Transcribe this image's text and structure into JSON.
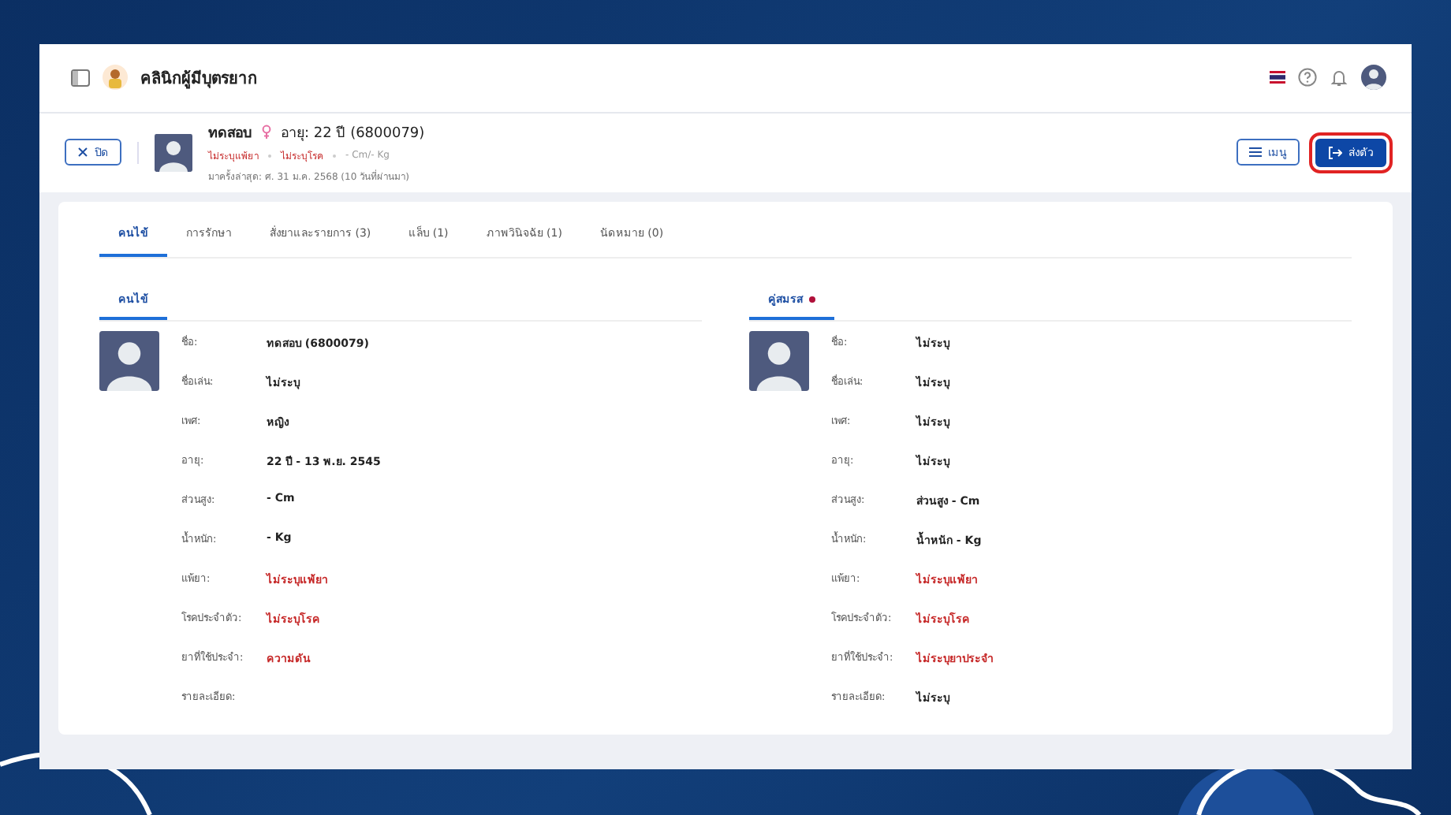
{
  "app_bar": {
    "title": "คลินิกผู้มีบุตรยาก"
  },
  "patient": {
    "name": "ทดสอบ",
    "age": "อายุ: 22 ปี (6800079)",
    "tags": [
      {
        "text": "ไม่ระบุแพ้ยา",
        "kind": "alert"
      },
      {
        "text": "ไม่ระบุโรค",
        "kind": "alert"
      },
      {
        "text": "- Cm/- Kg",
        "kind": "plain"
      }
    ],
    "last_visit": "มาครั้งล่าสุด: ศ. 31 ม.ค. 2568 (10 วันที่ผ่านมา)"
  },
  "close_button": "ปิด",
  "menu_button": "เมนู",
  "send_button": "ส่งตัว",
  "tabs": [
    {
      "label": "คนไข้",
      "selected": true
    },
    {
      "label": "การรักษา",
      "selected": false
    },
    {
      "label": "สั่งยาและรายการ (3)",
      "selected": false
    },
    {
      "label": "แล็บ (1)",
      "selected": false
    },
    {
      "label": "ภาพวินิจฉัย (1)",
      "selected": false
    },
    {
      "label": "นัดหมาย (0)",
      "selected": false
    }
  ],
  "panels": [
    {
      "title": "คนไข้",
      "fields": [
        {
          "label": "ชื่อ:",
          "value": "ทดสอบ (6800079)",
          "kind": "text"
        },
        {
          "label": "ชื่อเล่น:",
          "value": "ไม่ระบุ",
          "kind": "text"
        },
        {
          "label": "เพศ:",
          "value": "หญิง",
          "kind": "text"
        },
        {
          "label": "อายุ:",
          "value": "22 ปี - 13 พ.ย. 2545",
          "kind": "text"
        },
        {
          "label": "ส่วนสูง:",
          "value": "- Cm",
          "kind": "text"
        },
        {
          "label": "น้ำหนัก:",
          "value": "- Kg",
          "kind": "text"
        },
        {
          "label": "แพ้ยา:",
          "value": "ไม่ระบุแพ้ยา",
          "kind": "alert"
        },
        {
          "label": "โรคประจำตัว:",
          "value": "ไม่ระบุโรค",
          "kind": "alert"
        },
        {
          "label": "ยาที่ใช้ประจำ:",
          "value": "ความดัน",
          "kind": "alert"
        },
        {
          "label": "รายละเอียด:"
        }
      ]
    },
    {
      "title": "คู่สมรส",
      "color": "#b0103a",
      "fields": [
        {
          "label": "ชื่อ:",
          "value": "ไม่ระบุ",
          "kind": "text"
        },
        {
          "label": "ชื่อเล่น:",
          "value": "ไม่ระบุ",
          "kind": "text"
        },
        {
          "label": "เพศ:",
          "value": "ไม่ระบุ",
          "kind": "text"
        },
        {
          "label": "อายุ:",
          "value": "ไม่ระบุ",
          "kind": "text"
        },
        {
          "label": "ส่วนสูง:",
          "value": "ส่วนสูง - Cm",
          "kind": "text"
        },
        {
          "label": "น้ำหนัก:",
          "value": "น้ำหนัก - Kg",
          "kind": "text"
        },
        {
          "label": "แพ้ยา:",
          "value": "ไม่ระบุแพ้ยา",
          "kind": "alert"
        },
        {
          "label": "โรคประจำตัว:",
          "value": "ไม่ระบุโรค",
          "kind": "alert"
        },
        {
          "label": "ยาที่ใช้ประจำ:",
          "value": "ไม่ระบุยาประจำ",
          "kind": "alert"
        },
        {
          "label": "รายละเอียด:",
          "value": "ไม่ระบุ",
          "kind": "text"
        }
      ]
    }
  ]
}
